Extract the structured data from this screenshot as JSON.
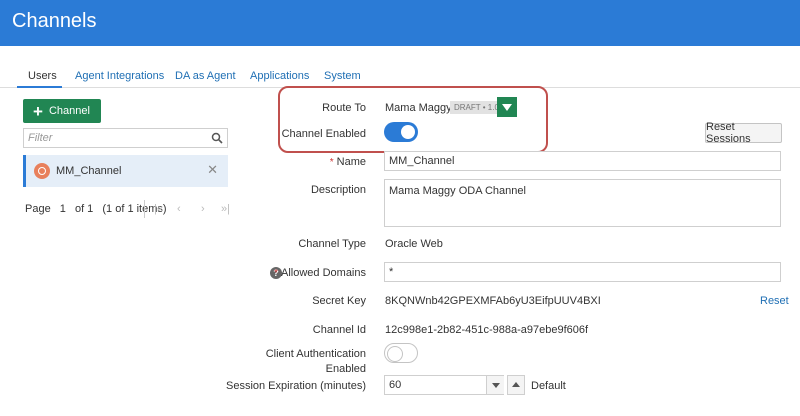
{
  "header": {
    "title": "Channels"
  },
  "tabs": [
    {
      "label": "Users"
    },
    {
      "label": "Agent Integrations"
    },
    {
      "label": "DA as Agent"
    },
    {
      "label": "Applications"
    },
    {
      "label": "System"
    }
  ],
  "sidebar": {
    "add_label": "Channel",
    "filter_placeholder": "Filter",
    "items": [
      {
        "name": "MM_Channel"
      }
    ],
    "pager": {
      "page_label": "Page",
      "page": "1",
      "of_label": "of 1",
      "items_info": "(1 of 1 items)"
    }
  },
  "form": {
    "route_to": {
      "label": "Route To",
      "value": "Mama Maggy",
      "badge": "DRAFT • 1.0"
    },
    "channel_enabled": {
      "label": "Channel Enabled",
      "on": true
    },
    "reset_sessions_label": "Reset Sessions",
    "name": {
      "label": "Name",
      "required_mark": "*",
      "value": "MM_Channel"
    },
    "description": {
      "label": "Description",
      "value": "Mama Maggy ODA Channel"
    },
    "channel_type": {
      "label": "Channel Type",
      "value": "Oracle Web"
    },
    "allowed_domains": {
      "label": "Allowed Domains",
      "required_mark": "*",
      "value": "*",
      "help_icon": "?"
    },
    "secret_key": {
      "label": "Secret Key",
      "value": "8KQNWnb42GPEXMFAb6yU3EifpUUV4BXI",
      "reset_label": "Reset"
    },
    "channel_id": {
      "label": "Channel Id",
      "value": "12c998e1-2b82-451c-988a-a97ebe9f606f"
    },
    "client_auth": {
      "label_line1": "Client Authentication",
      "label_line2": "Enabled",
      "on": false
    },
    "session_expiration": {
      "label": "Session Expiration (minutes)",
      "value": "60",
      "suffix": "Default"
    }
  },
  "colors": {
    "header_bg": "#2b7bd6",
    "primary_green": "#218653",
    "toggle_on": "#2b7bd6",
    "highlight": "#c0504d",
    "link": "#1f6fb4"
  }
}
